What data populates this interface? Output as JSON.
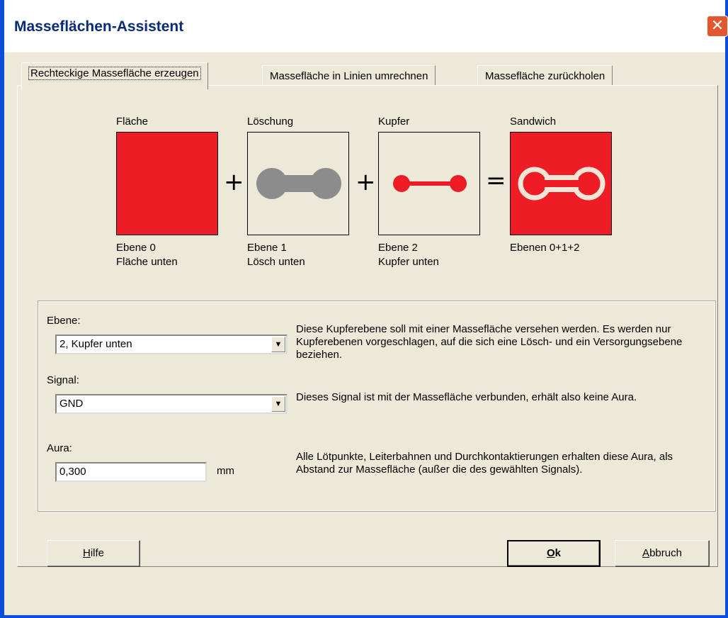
{
  "window": {
    "title": "Masseflächen-Assistent",
    "close_glyph": "✕"
  },
  "tabs": [
    {
      "label": "Rechteckige Massefläche erzeugen",
      "active": true
    },
    {
      "label": "Massefläche in Linien umrechnen",
      "active": false
    },
    {
      "label": "Massefläche zurückholen",
      "active": false
    }
  ],
  "diagram": {
    "panels": [
      {
        "title": "Fläche",
        "layer": "Ebene 0",
        "sublabel": "Fläche unten",
        "fill": "#EE1C25"
      },
      {
        "title": "Löschung",
        "layer": "Ebene 1",
        "sublabel": "Lösch unten",
        "fill": "#ECE9D8",
        "shape_color": "#8C8C8C"
      },
      {
        "title": "Kupfer",
        "layer": "Ebene 2",
        "sublabel": "Kupfer unten",
        "fill": "#ECE9D8",
        "shape_color": "#EE1C25"
      },
      {
        "title": "Sandwich",
        "layer": "Ebenen 0+1+2",
        "sublabel": "",
        "fill": "#EE1C25",
        "shape_color": "#F3E6D8"
      }
    ],
    "operators": [
      "+",
      "+",
      "="
    ]
  },
  "form": {
    "ebene": {
      "label": "Ebene:",
      "value": "2, Kupfer unten",
      "description": "Diese Kupferebene soll mit einer Massefläche versehen werden. Es werden nur Kupferebenen vorgeschlagen, auf die sich eine Lösch- und ein Versorgungsebene beziehen."
    },
    "signal": {
      "label": "Signal:",
      "value": "GND",
      "description": "Dieses Signal ist mit der Massefläche verbunden, erhält also keine Aura."
    },
    "aura": {
      "label": "Aura:",
      "value": "0,300",
      "unit": "mm",
      "description": "Alle Lötpunkte, Leiterbahnen und Durchkontaktierungen erhalten diese Aura, als Abstand zur Massefläche (außer die des gewählten Signals)."
    }
  },
  "buttons": {
    "help": {
      "first": "H",
      "rest": "ilfe"
    },
    "ok": {
      "first": "O",
      "rest": "k"
    },
    "cancel": {
      "first": "A",
      "rest": "bbruch"
    }
  },
  "colors": {
    "accent_red": "#EE1C25",
    "titlebar_blue": "#0A4DDB",
    "dialog_bg": "#ECE9D8"
  }
}
